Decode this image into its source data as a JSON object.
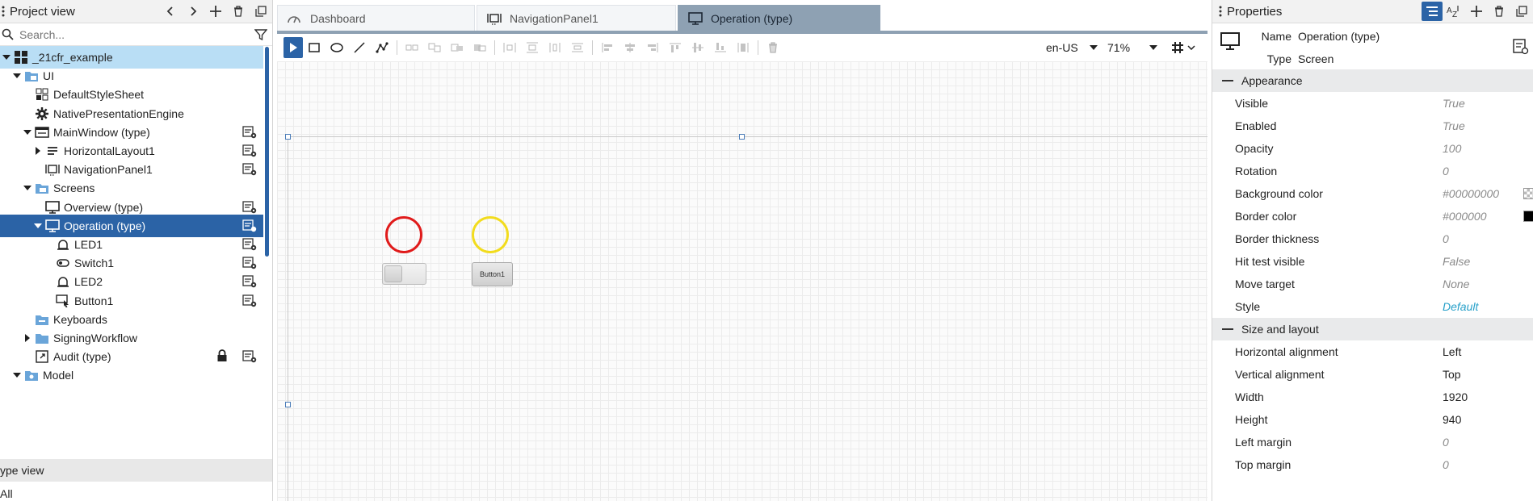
{
  "project_view": {
    "title": "Project view",
    "search_placeholder": "Search...",
    "tree": [
      {
        "label": "_21cfr_example",
        "level": 0,
        "icon": "project-icon",
        "twisty": "down",
        "state": "root"
      },
      {
        "label": "UI",
        "level": 1,
        "icon": "ui-folder-icon",
        "twisty": "down"
      },
      {
        "label": "DefaultStyleSheet",
        "level": 2,
        "icon": "stylesheet-icon"
      },
      {
        "label": "NativePresentationEngine",
        "level": 2,
        "icon": "gear-icon"
      },
      {
        "label": "MainWindow (type)",
        "level": 2,
        "icon": "window-icon",
        "twisty": "down",
        "action": true
      },
      {
        "label": "HorizontalLayout1",
        "level": 3,
        "icon": "layout-icon",
        "twisty": "right",
        "action": true
      },
      {
        "label": "NavigationPanel1",
        "level": 3,
        "icon": "navpanel-icon",
        "action": true
      },
      {
        "label": "Screens",
        "level": 2,
        "icon": "screens-folder-icon",
        "twisty": "down"
      },
      {
        "label": "Overview (type)",
        "level": 3,
        "icon": "screen-icon",
        "action": true
      },
      {
        "label": "Operation (type)",
        "level": 3,
        "icon": "screen-icon",
        "twisty": "down",
        "action": true,
        "state": "selected"
      },
      {
        "label": "LED1",
        "level": 4,
        "icon": "led-icon",
        "action": true
      },
      {
        "label": "Switch1",
        "level": 4,
        "icon": "switch-icon",
        "action": true
      },
      {
        "label": "LED2",
        "level": 4,
        "icon": "led-icon",
        "action": true
      },
      {
        "label": "Button1",
        "level": 4,
        "icon": "button-icon",
        "action": true
      },
      {
        "label": "Keyboards",
        "level": 2,
        "icon": "keyboards-folder-icon"
      },
      {
        "label": "SigningWorkflow",
        "level": 2,
        "icon": "folder-icon",
        "twisty": "right"
      },
      {
        "label": "Audit (type)",
        "level": 2,
        "icon": "dialog-icon",
        "action": true,
        "locked": true
      },
      {
        "label": "Model",
        "level": 1,
        "icon": "model-icon",
        "twisty": "down"
      }
    ],
    "type_view_title": "ype view",
    "type_view_filter": "All"
  },
  "editor": {
    "tabs": [
      {
        "label": "Dashboard",
        "icon": "dashboard-icon",
        "active": false
      },
      {
        "label": "NavigationPanel1",
        "icon": "navpanel-icon",
        "active": false
      },
      {
        "label": "Operation (type)",
        "icon": "screen-icon",
        "active": true
      }
    ],
    "locale": "en-US",
    "zoom": "71%",
    "canvas": {
      "led1_color": "#e01b1b",
      "led2_color": "#f2dc1e",
      "button_label": "Button1"
    }
  },
  "properties": {
    "title": "Properties",
    "name_label": "Name",
    "name_value": "Operation (type)",
    "type_label": "Type",
    "type_value": "Screen",
    "appearance": {
      "title": "Appearance",
      "rows": [
        {
          "key": "Visible",
          "value": "True",
          "style": "def"
        },
        {
          "key": "Enabled",
          "value": "True",
          "style": "def"
        },
        {
          "key": "Opacity",
          "value": "100",
          "style": "def"
        },
        {
          "key": "Rotation",
          "value": "0",
          "style": "def"
        },
        {
          "key": "Background color",
          "value": "#00000000",
          "style": "def",
          "swatch": "transparent"
        },
        {
          "key": "Border color",
          "value": "#000000",
          "style": "def",
          "swatch": "#000000"
        },
        {
          "key": "Border thickness",
          "value": "0",
          "style": "def"
        },
        {
          "key": "Hit test visible",
          "value": "False",
          "style": "def"
        },
        {
          "key": "Move target",
          "value": "None",
          "style": "def"
        },
        {
          "key": "Style",
          "value": "Default",
          "style": "link"
        }
      ]
    },
    "size_layout": {
      "title": "Size and layout",
      "rows": [
        {
          "key": "Horizontal alignment",
          "value": "Left",
          "style": "set"
        },
        {
          "key": "Vertical alignment",
          "value": "Top",
          "style": "set"
        },
        {
          "key": "Width",
          "value": "1920",
          "style": "set"
        },
        {
          "key": "Height",
          "value": "940",
          "style": "set"
        },
        {
          "key": "Left margin",
          "value": "0",
          "style": "def"
        },
        {
          "key": "Top margin",
          "value": "0",
          "style": "def"
        }
      ]
    }
  },
  "colors": {
    "selection": "#2b63a6",
    "root_highlight": "#b9def5",
    "active_tab": "#8ea1b3",
    "link": "#27a0c9"
  }
}
